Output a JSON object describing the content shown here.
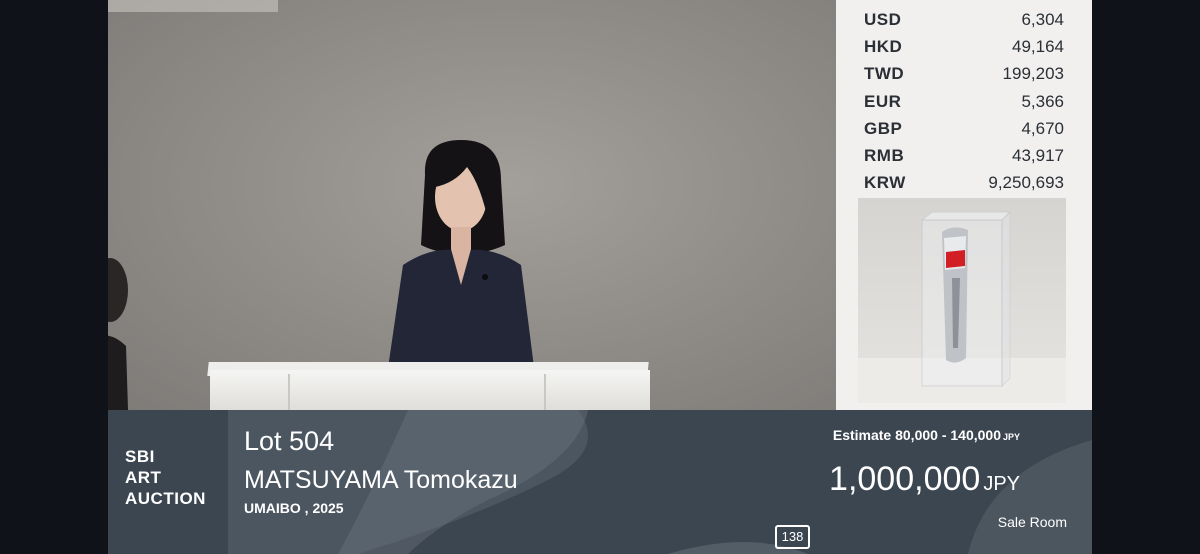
{
  "currency_panel": {
    "rates": [
      {
        "code": "USD",
        "value": "6,304"
      },
      {
        "code": "HKD",
        "value": "49,164"
      },
      {
        "code": "TWD",
        "value": "199,203"
      },
      {
        "code": "EUR",
        "value": "5,366"
      },
      {
        "code": "GBP",
        "value": "4,670"
      },
      {
        "code": "RMB",
        "value": "43,917"
      },
      {
        "code": "KRW",
        "value": "9,250,693"
      }
    ]
  },
  "info_bar": {
    "logo_lines": [
      "SBI",
      "ART",
      "AUCTION"
    ],
    "lot": "Lot 504",
    "artist": "MATSUYAMA Tomokazu",
    "work": "UMAIBO , 2025",
    "estimate_label": "Estimate 80,000 - 140,000",
    "estimate_currency": "JPY",
    "current_price": "1,000,000",
    "price_currency": "JPY",
    "sale_room": "Sale Room",
    "counter": "138"
  },
  "colors": {
    "bar_background": "#3c4650",
    "panel_background": "#f1f0ee",
    "text_light": "#ffffff",
    "text_dark": "#2b2f36"
  }
}
